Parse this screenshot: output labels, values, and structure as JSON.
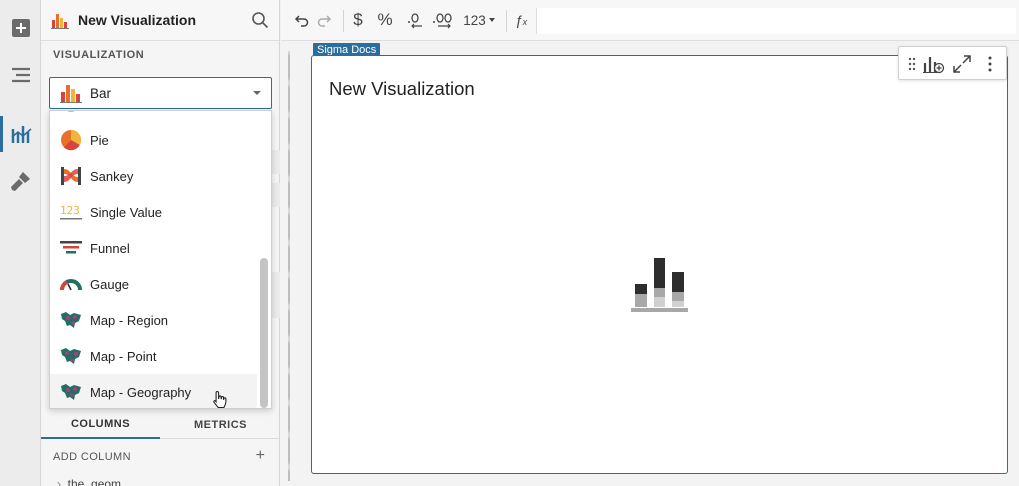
{
  "panel": {
    "title": "New Visualization",
    "section_label": "VISUALIZATION",
    "selected_type": "Bar",
    "tabs": [
      "COLUMNS",
      "METRICS"
    ],
    "add_column": "ADD COLUMN",
    "column_partial": "the_geom"
  },
  "dropdown": {
    "items": [
      {
        "label": "Pie",
        "icon": "pie-chart-icon"
      },
      {
        "label": "Sankey",
        "icon": "sankey-icon"
      },
      {
        "label": "Single Value",
        "icon": "single-value-icon"
      },
      {
        "label": "Funnel",
        "icon": "funnel-icon"
      },
      {
        "label": "Gauge",
        "icon": "gauge-icon"
      },
      {
        "label": "Map - Region",
        "icon": "map-region-icon"
      },
      {
        "label": "Map - Point",
        "icon": "map-point-icon"
      },
      {
        "label": "Map - Geography",
        "icon": "map-geography-icon"
      }
    ],
    "hovered": "Map - Geography"
  },
  "toolbar": {
    "number_format": "123"
  },
  "card": {
    "tag": "Sigma Docs",
    "title": "New Visualization"
  },
  "colors": {
    "accent": "#2b6e9e",
    "bar_orange": "#e8702a",
    "bar_red": "#d6453d",
    "bar_yellow": "#f0b53c"
  }
}
